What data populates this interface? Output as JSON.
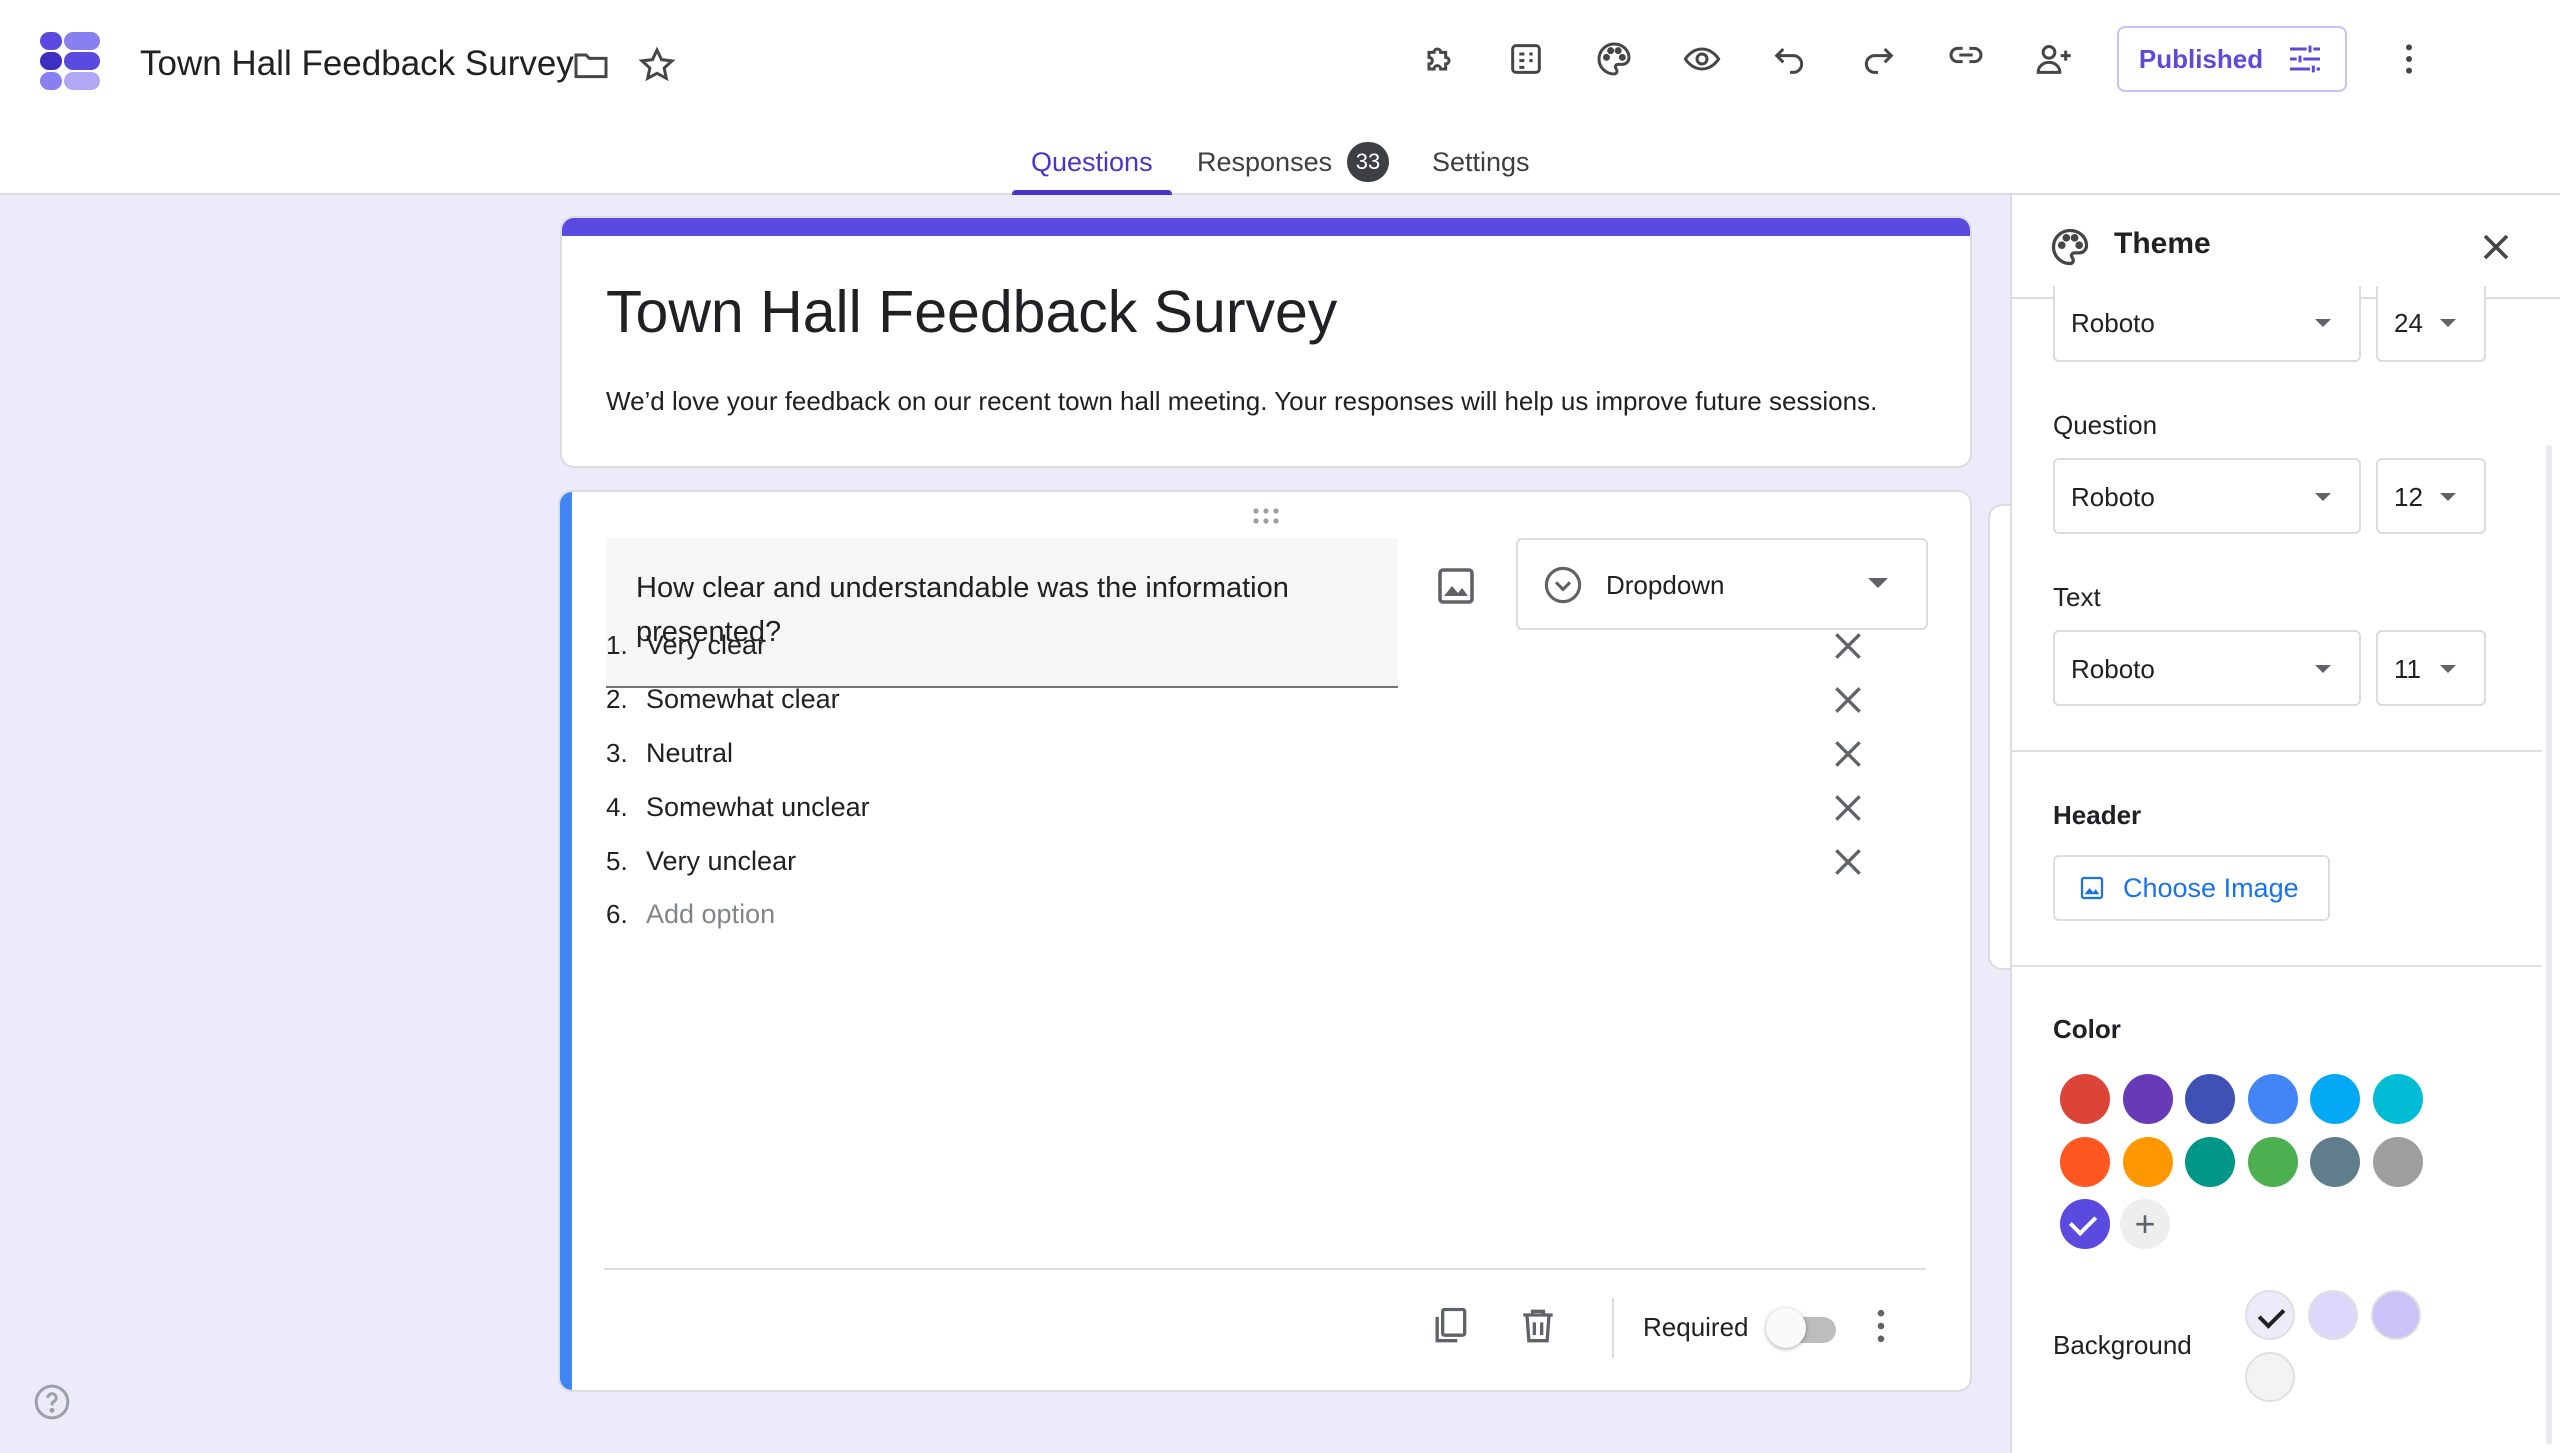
{
  "header": {
    "title": "Town Hall Feedback Survey",
    "published_label": "Published"
  },
  "tabs": [
    {
      "label": "Questions",
      "active": true
    },
    {
      "label": "Responses",
      "badge": "33"
    },
    {
      "label": "Settings"
    }
  ],
  "form": {
    "title": "Town Hall Feedback Survey",
    "description": "We’d love your feedback on our recent town hall meeting. Your responses will help us improve future sessions."
  },
  "question": {
    "text": "How clear and understandable was the information presented?",
    "type": "Dropdown",
    "options": [
      {
        "num": "1.",
        "label": "Very clear"
      },
      {
        "num": "2.",
        "label": "Somewhat clear"
      },
      {
        "num": "3.",
        "label": "Neutral"
      },
      {
        "num": "4.",
        "label": "Somewhat unclear"
      },
      {
        "num": "5.",
        "label": "Very unclear"
      }
    ],
    "add_option": {
      "num": "6.",
      "label": "Add option"
    },
    "required_label": "Required",
    "required": false
  },
  "theme": {
    "title": "Theme",
    "header_font": {
      "font": "Roboto",
      "size": "24"
    },
    "question_label": "Question",
    "question_font": {
      "font": "Roboto",
      "size": "12"
    },
    "text_label": "Text",
    "text_font": {
      "font": "Roboto",
      "size": "11"
    },
    "header_label": "Header",
    "choose_image_label": "Choose Image",
    "color_label": "Color",
    "colors": [
      "#db4437",
      "#673ab7",
      "#3f51b5",
      "#4285f4",
      "#03a9f4",
      "#00bcd4",
      "#ff5722",
      "#ff9800",
      "#009688",
      "#4caf50",
      "#607d8b",
      "#9e9e9e",
      "#5b4ae0"
    ],
    "selected_color": "#5b4ae0",
    "background_label": "Background",
    "backgrounds": [
      "#edeafa",
      "#dcd7fb",
      "#cbc2f8",
      "#f1f3f4"
    ],
    "selected_background": "#edeafa"
  },
  "icons": [
    "addon-icon",
    "customize-icon",
    "palette-icon",
    "preview-icon",
    "undo-icon",
    "redo-icon",
    "link-icon",
    "add-collaborator-icon",
    "tune-icon",
    "more-vert-icon",
    "folder-icon",
    "star-icon"
  ]
}
